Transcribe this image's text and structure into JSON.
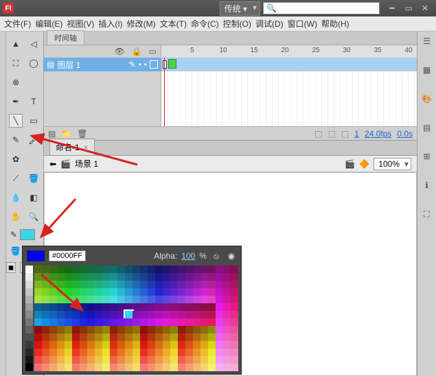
{
  "titlebar": {
    "workspace_label": "传统 ▾",
    "search_placeholder": ""
  },
  "menus": {
    "file": "文件(F)",
    "edit": "编辑(E)",
    "view": "视图(V)",
    "insert": "插入(I)",
    "modify": "修改(M)",
    "text": "文本(T)",
    "command": "命令(C)",
    "control": "控制(O)",
    "debug": "调试(D)",
    "window": "窗口(W)",
    "help": "帮助(H)"
  },
  "timeline": {
    "tab_label": "时间轴",
    "layer1_label": "图层 1",
    "ruler_marks": [
      "5",
      "10",
      "15",
      "20",
      "25",
      "30",
      "35",
      "40"
    ],
    "status_frame": "1",
    "status_fps": "24.0fps",
    "status_time": "0.0s"
  },
  "document": {
    "tab_label": "命名-1",
    "scene_label": "场景 1",
    "zoom": "100%"
  },
  "color_picker": {
    "hex": "#0000FF",
    "alpha_label": "Alpha:",
    "alpha_value": "100",
    "alpha_pct": "%"
  }
}
